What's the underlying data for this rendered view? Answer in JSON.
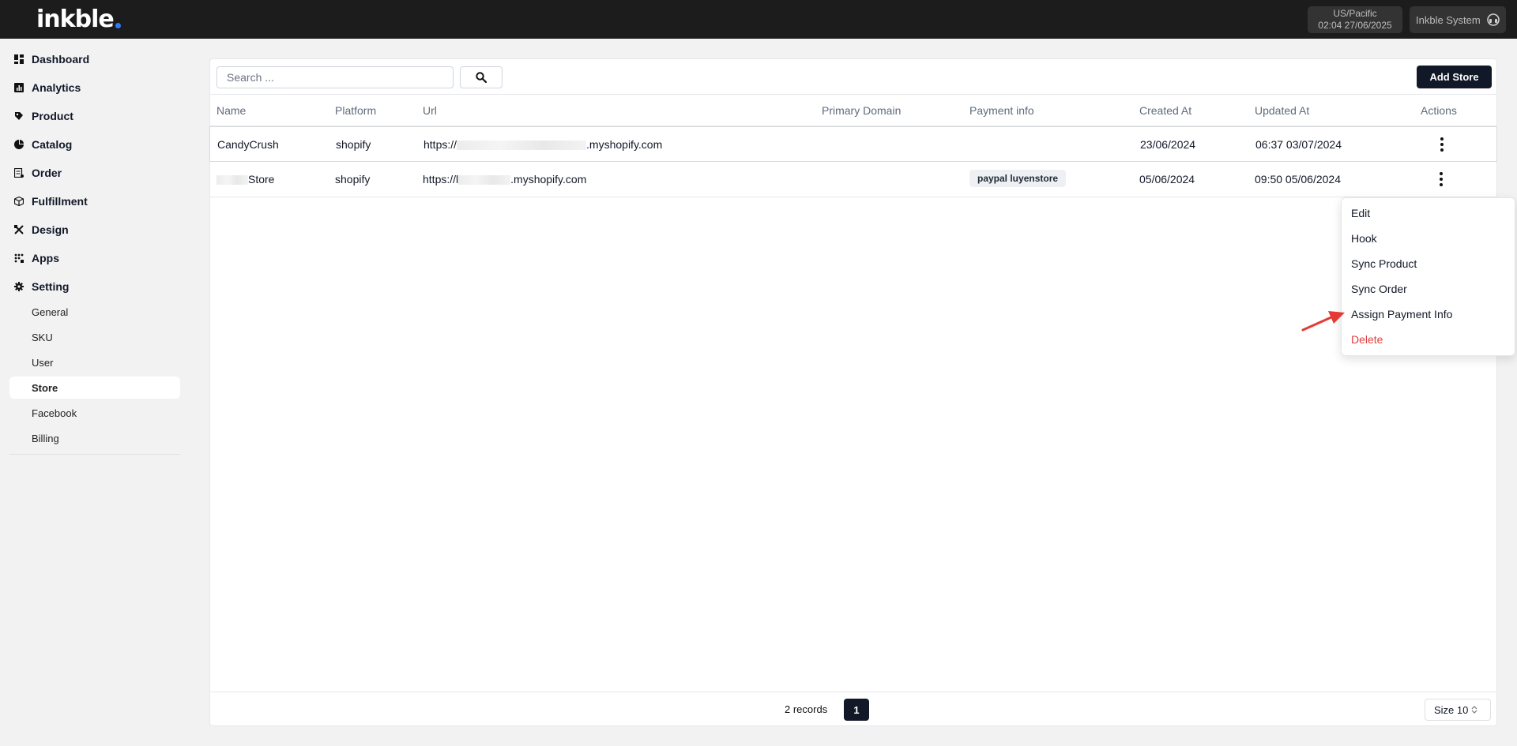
{
  "header": {
    "logo_text": "inkble",
    "logo_dot_color": "#2f7bf5",
    "timezone": "US/Pacific",
    "datetime": "02:04 27/06/2025",
    "user_name": "Inkble System"
  },
  "sidebar": {
    "items": [
      {
        "label": "Dashboard",
        "icon": "dashboard-icon"
      },
      {
        "label": "Analytics",
        "icon": "analytics-icon"
      },
      {
        "label": "Product",
        "icon": "product-icon"
      },
      {
        "label": "Catalog",
        "icon": "catalog-icon"
      },
      {
        "label": "Order",
        "icon": "order-icon"
      },
      {
        "label": "Fulfillment",
        "icon": "fulfillment-icon"
      },
      {
        "label": "Design",
        "icon": "design-icon"
      },
      {
        "label": "Apps",
        "icon": "apps-icon"
      },
      {
        "label": "Setting",
        "icon": "gear-icon"
      }
    ],
    "setting_subitems": [
      {
        "label": "General"
      },
      {
        "label": "SKU"
      },
      {
        "label": "User"
      },
      {
        "label": "Store",
        "active": true
      },
      {
        "label": "Facebook"
      },
      {
        "label": "Billing"
      }
    ]
  },
  "toolbar": {
    "search_placeholder": "Search ...",
    "add_store_label": "Add Store"
  },
  "table": {
    "columns": [
      "Name",
      "Platform",
      "Url",
      "Primary Domain",
      "Payment info",
      "Created At",
      "Updated At",
      "Actions"
    ],
    "rows": [
      {
        "name": "CandyCrush",
        "platform": "shopify",
        "url_prefix": "https://",
        "url_suffix": ".myshopify.com",
        "primary_domain": "",
        "payment_info": "",
        "created_at": "23/06/2024",
        "updated_at": "06:37 03/07/2024"
      },
      {
        "name": "Store",
        "platform": "shopify",
        "url_prefix": "https://l",
        "url_suffix": ".myshopify.com",
        "primary_domain": "",
        "payment_info": "paypal luyenstore",
        "created_at": "05/06/2024",
        "updated_at": "09:50 05/06/2024"
      }
    ]
  },
  "footer": {
    "records": "2 records",
    "current_page": "1",
    "page_size": "Size 10"
  },
  "actions_menu": {
    "items": [
      "Edit",
      "Hook",
      "Sync Product",
      "Sync Order",
      "Assign Payment Info",
      "Delete"
    ]
  },
  "colors": {
    "topbar": "#1c1c1c",
    "primary_button": "#111827",
    "danger": "#e03e3e",
    "annotation_arrow": "#e53935"
  }
}
